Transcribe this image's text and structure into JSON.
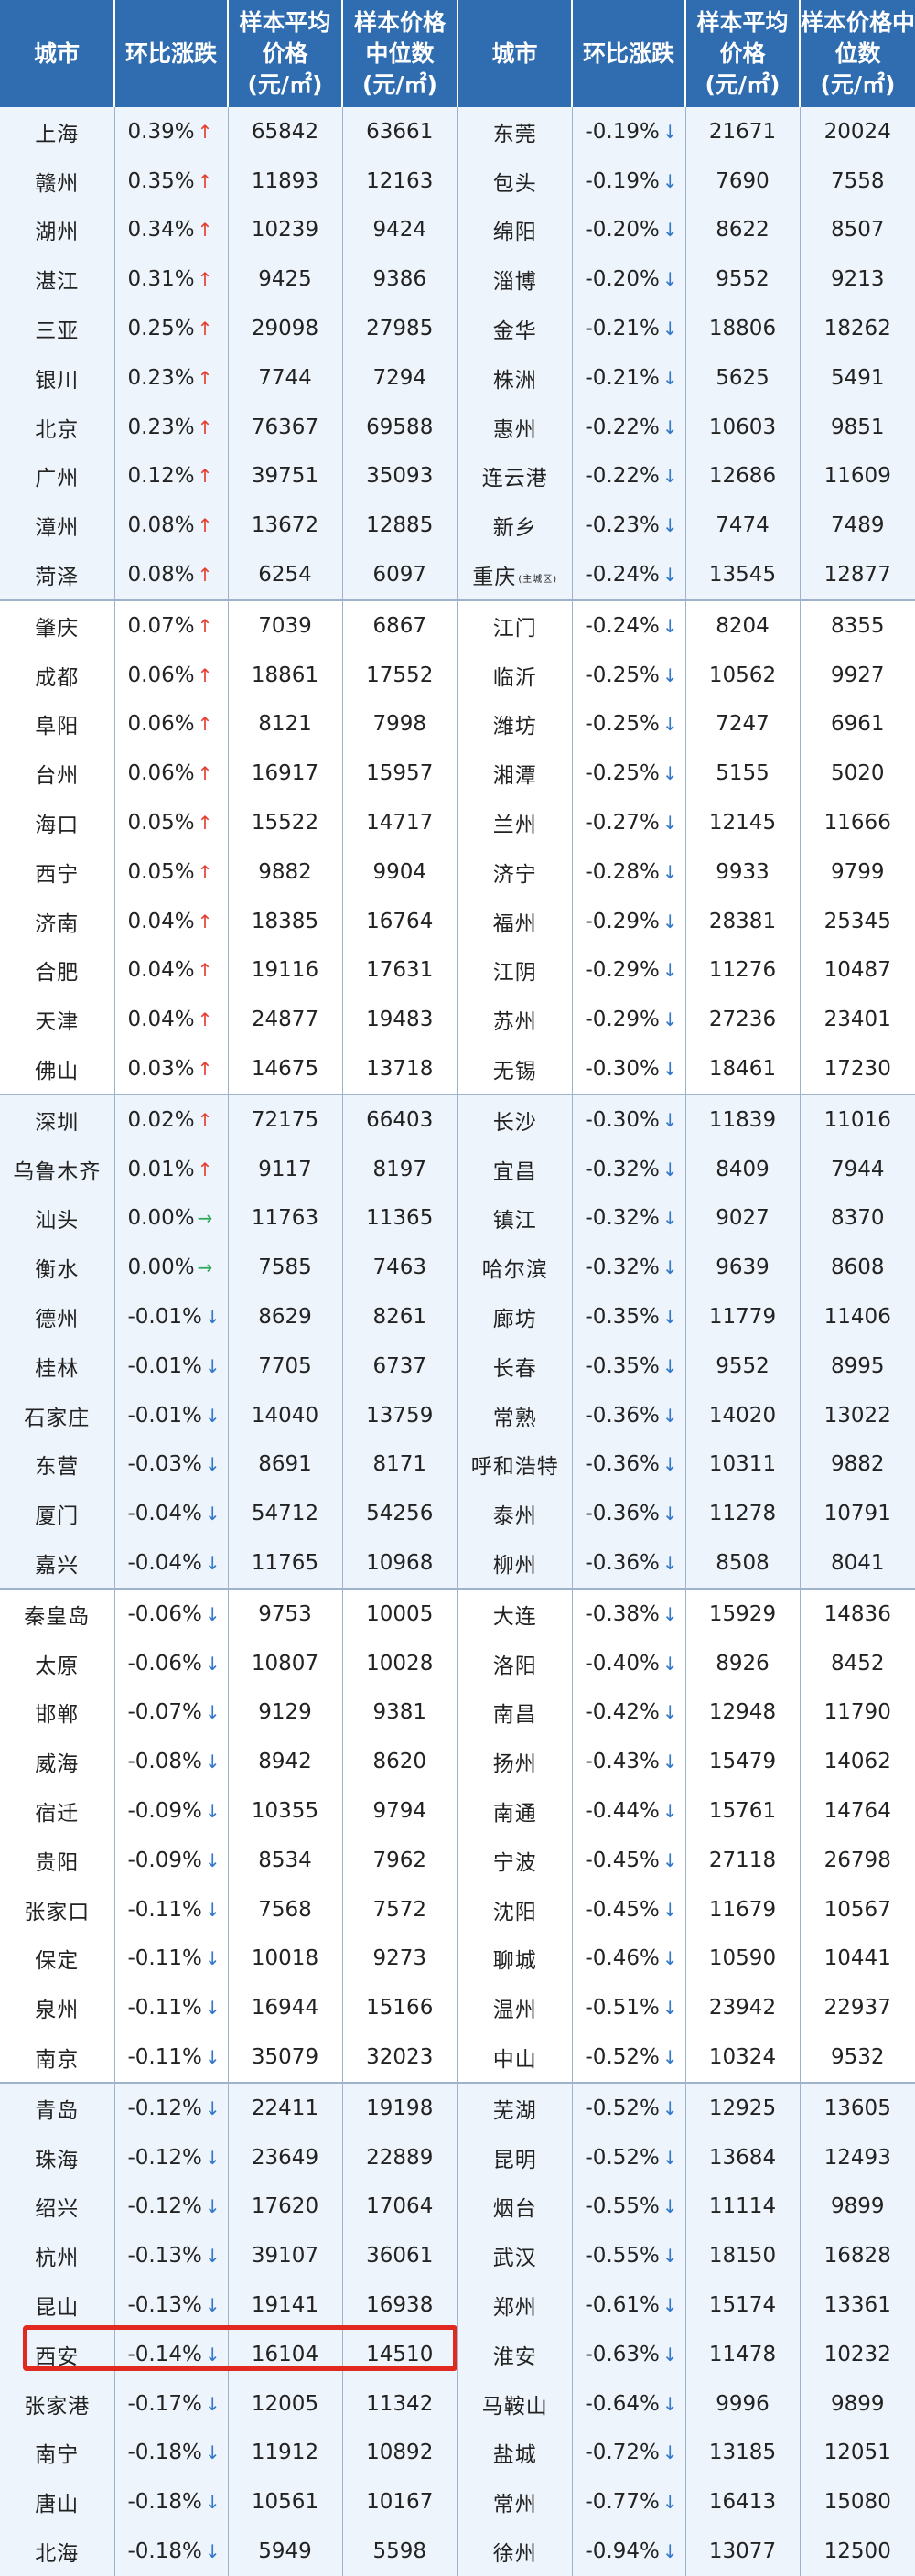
{
  "header": {
    "city": "城市",
    "change": "环比涨跌",
    "avg_price": "样本平均价格",
    "avg_unit": "(元/㎡)",
    "median_price": "样本价格中位数",
    "median_unit": "(元/㎡)"
  },
  "highlighted_city": "西安",
  "colors": {
    "header_bg": "#2f6db0",
    "up": "#e43d30",
    "down": "#3378c9",
    "flat": "#2aa75a",
    "highlight": "#e1291f"
  },
  "rows": [
    {
      "left": {
        "city": "上海",
        "change": "0.39%",
        "dir": "up",
        "avg": "65842",
        "median": "63661"
      },
      "right": {
        "city": "东莞",
        "change": "-0.19%",
        "dir": "down",
        "avg": "21671",
        "median": "20024"
      }
    },
    {
      "left": {
        "city": "赣州",
        "change": "0.35%",
        "dir": "up",
        "avg": "11893",
        "median": "12163"
      },
      "right": {
        "city": "包头",
        "change": "-0.19%",
        "dir": "down",
        "avg": "7690",
        "median": "7558"
      }
    },
    {
      "left": {
        "city": "湖州",
        "change": "0.34%",
        "dir": "up",
        "avg": "10239",
        "median": "9424"
      },
      "right": {
        "city": "绵阳",
        "change": "-0.20%",
        "dir": "down",
        "avg": "8622",
        "median": "8507"
      }
    },
    {
      "left": {
        "city": "湛江",
        "change": "0.31%",
        "dir": "up",
        "avg": "9425",
        "median": "9386"
      },
      "right": {
        "city": "淄博",
        "change": "-0.20%",
        "dir": "down",
        "avg": "9552",
        "median": "9213"
      }
    },
    {
      "left": {
        "city": "三亚",
        "change": "0.25%",
        "dir": "up",
        "avg": "29098",
        "median": "27985"
      },
      "right": {
        "city": "金华",
        "change": "-0.21%",
        "dir": "down",
        "avg": "18806",
        "median": "18262"
      }
    },
    {
      "left": {
        "city": "银川",
        "change": "0.23%",
        "dir": "up",
        "avg": "7744",
        "median": "7294"
      },
      "right": {
        "city": "株洲",
        "change": "-0.21%",
        "dir": "down",
        "avg": "5625",
        "median": "5491"
      }
    },
    {
      "left": {
        "city": "北京",
        "change": "0.23%",
        "dir": "up",
        "avg": "76367",
        "median": "69588"
      },
      "right": {
        "city": "惠州",
        "change": "-0.22%",
        "dir": "down",
        "avg": "10603",
        "median": "9851"
      }
    },
    {
      "left": {
        "city": "广州",
        "change": "0.12%",
        "dir": "up",
        "avg": "39751",
        "median": "35093"
      },
      "right": {
        "city": "连云港",
        "change": "-0.22%",
        "dir": "down",
        "avg": "12686",
        "median": "11609"
      }
    },
    {
      "left": {
        "city": "漳州",
        "change": "0.08%",
        "dir": "up",
        "avg": "13672",
        "median": "12885"
      },
      "right": {
        "city": "新乡",
        "change": "-0.23%",
        "dir": "down",
        "avg": "7474",
        "median": "7489"
      }
    },
    {
      "left": {
        "city": "菏泽",
        "change": "0.08%",
        "dir": "up",
        "avg": "6254",
        "median": "6097"
      },
      "right": {
        "city": "重庆",
        "suffix": "(主城区)",
        "change": "-0.24%",
        "dir": "down",
        "avg": "13545",
        "median": "12877"
      }
    },
    {
      "left": {
        "city": "肇庆",
        "change": "0.07%",
        "dir": "up",
        "avg": "7039",
        "median": "6867"
      },
      "right": {
        "city": "江门",
        "change": "-0.24%",
        "dir": "down",
        "avg": "8204",
        "median": "8355"
      }
    },
    {
      "left": {
        "city": "成都",
        "change": "0.06%",
        "dir": "up",
        "avg": "18861",
        "median": "17552"
      },
      "right": {
        "city": "临沂",
        "change": "-0.25%",
        "dir": "down",
        "avg": "10562",
        "median": "9927"
      }
    },
    {
      "left": {
        "city": "阜阳",
        "change": "0.06%",
        "dir": "up",
        "avg": "8121",
        "median": "7998"
      },
      "right": {
        "city": "潍坊",
        "change": "-0.25%",
        "dir": "down",
        "avg": "7247",
        "median": "6961"
      }
    },
    {
      "left": {
        "city": "台州",
        "change": "0.06%",
        "dir": "up",
        "avg": "16917",
        "median": "15957"
      },
      "right": {
        "city": "湘潭",
        "change": "-0.25%",
        "dir": "down",
        "avg": "5155",
        "median": "5020"
      }
    },
    {
      "left": {
        "city": "海口",
        "change": "0.05%",
        "dir": "up",
        "avg": "15522",
        "median": "14717"
      },
      "right": {
        "city": "兰州",
        "change": "-0.27%",
        "dir": "down",
        "avg": "12145",
        "median": "11666"
      }
    },
    {
      "left": {
        "city": "西宁",
        "change": "0.05%",
        "dir": "up",
        "avg": "9882",
        "median": "9904"
      },
      "right": {
        "city": "济宁",
        "change": "-0.28%",
        "dir": "down",
        "avg": "9933",
        "median": "9799"
      }
    },
    {
      "left": {
        "city": "济南",
        "change": "0.04%",
        "dir": "up",
        "avg": "18385",
        "median": "16764"
      },
      "right": {
        "city": "福州",
        "change": "-0.29%",
        "dir": "down",
        "avg": "28381",
        "median": "25345"
      }
    },
    {
      "left": {
        "city": "合肥",
        "change": "0.04%",
        "dir": "up",
        "avg": "19116",
        "median": "17631"
      },
      "right": {
        "city": "江阴",
        "change": "-0.29%",
        "dir": "down",
        "avg": "11276",
        "median": "10487"
      }
    },
    {
      "left": {
        "city": "天津",
        "change": "0.04%",
        "dir": "up",
        "avg": "24877",
        "median": "19483"
      },
      "right": {
        "city": "苏州",
        "change": "-0.29%",
        "dir": "down",
        "avg": "27236",
        "median": "23401"
      }
    },
    {
      "left": {
        "city": "佛山",
        "change": "0.03%",
        "dir": "up",
        "avg": "14675",
        "median": "13718"
      },
      "right": {
        "city": "无锡",
        "change": "-0.30%",
        "dir": "down",
        "avg": "18461",
        "median": "17230"
      }
    },
    {
      "left": {
        "city": "深圳",
        "change": "0.02%",
        "dir": "up",
        "avg": "72175",
        "median": "66403"
      },
      "right": {
        "city": "长沙",
        "change": "-0.30%",
        "dir": "down",
        "avg": "11839",
        "median": "11016"
      }
    },
    {
      "left": {
        "city": "乌鲁木齐",
        "change": "0.01%",
        "dir": "up",
        "avg": "9117",
        "median": "8197"
      },
      "right": {
        "city": "宜昌",
        "change": "-0.32%",
        "dir": "down",
        "avg": "8409",
        "median": "7944"
      }
    },
    {
      "left": {
        "city": "汕头",
        "change": "0.00%",
        "dir": "flat",
        "avg": "11763",
        "median": "11365"
      },
      "right": {
        "city": "镇江",
        "change": "-0.32%",
        "dir": "down",
        "avg": "9027",
        "median": "8370"
      }
    },
    {
      "left": {
        "city": "衡水",
        "change": "0.00%",
        "dir": "flat",
        "avg": "7585",
        "median": "7463"
      },
      "right": {
        "city": "哈尔滨",
        "change": "-0.32%",
        "dir": "down",
        "avg": "9639",
        "median": "8608"
      }
    },
    {
      "left": {
        "city": "德州",
        "change": "-0.01%",
        "dir": "down",
        "avg": "8629",
        "median": "8261"
      },
      "right": {
        "city": "廊坊",
        "change": "-0.35%",
        "dir": "down",
        "avg": "11779",
        "median": "11406"
      }
    },
    {
      "left": {
        "city": "桂林",
        "change": "-0.01%",
        "dir": "down",
        "avg": "7705",
        "median": "6737"
      },
      "right": {
        "city": "长春",
        "change": "-0.35%",
        "dir": "down",
        "avg": "9552",
        "median": "8995"
      }
    },
    {
      "left": {
        "city": "石家庄",
        "change": "-0.01%",
        "dir": "down",
        "avg": "14040",
        "median": "13759"
      },
      "right": {
        "city": "常熟",
        "change": "-0.36%",
        "dir": "down",
        "avg": "14020",
        "median": "13022"
      }
    },
    {
      "left": {
        "city": "东营",
        "change": "-0.03%",
        "dir": "down",
        "avg": "8691",
        "median": "8171"
      },
      "right": {
        "city": "呼和浩特",
        "change": "-0.36%",
        "dir": "down",
        "avg": "10311",
        "median": "9882"
      }
    },
    {
      "left": {
        "city": "厦门",
        "change": "-0.04%",
        "dir": "down",
        "avg": "54712",
        "median": "54256"
      },
      "right": {
        "city": "泰州",
        "change": "-0.36%",
        "dir": "down",
        "avg": "11278",
        "median": "10791"
      }
    },
    {
      "left": {
        "city": "嘉兴",
        "change": "-0.04%",
        "dir": "down",
        "avg": "11765",
        "median": "10968"
      },
      "right": {
        "city": "柳州",
        "change": "-0.36%",
        "dir": "down",
        "avg": "8508",
        "median": "8041"
      }
    },
    {
      "left": {
        "city": "秦皇岛",
        "change": "-0.06%",
        "dir": "down",
        "avg": "9753",
        "median": "10005"
      },
      "right": {
        "city": "大连",
        "change": "-0.38%",
        "dir": "down",
        "avg": "15929",
        "median": "14836"
      }
    },
    {
      "left": {
        "city": "太原",
        "change": "-0.06%",
        "dir": "down",
        "avg": "10807",
        "median": "10028"
      },
      "right": {
        "city": "洛阳",
        "change": "-0.40%",
        "dir": "down",
        "avg": "8926",
        "median": "8452"
      }
    },
    {
      "left": {
        "city": "邯郸",
        "change": "-0.07%",
        "dir": "down",
        "avg": "9129",
        "median": "9381"
      },
      "right": {
        "city": "南昌",
        "change": "-0.42%",
        "dir": "down",
        "avg": "12948",
        "median": "11790"
      }
    },
    {
      "left": {
        "city": "威海",
        "change": "-0.08%",
        "dir": "down",
        "avg": "8942",
        "median": "8620"
      },
      "right": {
        "city": "扬州",
        "change": "-0.43%",
        "dir": "down",
        "avg": "15479",
        "median": "14062"
      }
    },
    {
      "left": {
        "city": "宿迁",
        "change": "-0.09%",
        "dir": "down",
        "avg": "10355",
        "median": "9794"
      },
      "right": {
        "city": "南通",
        "change": "-0.44%",
        "dir": "down",
        "avg": "15761",
        "median": "14764"
      }
    },
    {
      "left": {
        "city": "贵阳",
        "change": "-0.09%",
        "dir": "down",
        "avg": "8534",
        "median": "7962"
      },
      "right": {
        "city": "宁波",
        "change": "-0.45%",
        "dir": "down",
        "avg": "27118",
        "median": "26798"
      }
    },
    {
      "left": {
        "city": "张家口",
        "change": "-0.11%",
        "dir": "down",
        "avg": "7568",
        "median": "7572"
      },
      "right": {
        "city": "沈阳",
        "change": "-0.45%",
        "dir": "down",
        "avg": "11679",
        "median": "10567"
      }
    },
    {
      "left": {
        "city": "保定",
        "change": "-0.11%",
        "dir": "down",
        "avg": "10018",
        "median": "9273"
      },
      "right": {
        "city": "聊城",
        "change": "-0.46%",
        "dir": "down",
        "avg": "10590",
        "median": "10441"
      }
    },
    {
      "left": {
        "city": "泉州",
        "change": "-0.11%",
        "dir": "down",
        "avg": "16944",
        "median": "15166"
      },
      "right": {
        "city": "温州",
        "change": "-0.51%",
        "dir": "down",
        "avg": "23942",
        "median": "22937"
      }
    },
    {
      "left": {
        "city": "南京",
        "change": "-0.11%",
        "dir": "down",
        "avg": "35079",
        "median": "32023"
      },
      "right": {
        "city": "中山",
        "change": "-0.52%",
        "dir": "down",
        "avg": "10324",
        "median": "9532"
      }
    },
    {
      "left": {
        "city": "青岛",
        "change": "-0.12%",
        "dir": "down",
        "avg": "22411",
        "median": "19198"
      },
      "right": {
        "city": "芜湖",
        "change": "-0.52%",
        "dir": "down",
        "avg": "12925",
        "median": "13605"
      }
    },
    {
      "left": {
        "city": "珠海",
        "change": "-0.12%",
        "dir": "down",
        "avg": "23649",
        "median": "22889"
      },
      "right": {
        "city": "昆明",
        "change": "-0.52%",
        "dir": "down",
        "avg": "13684",
        "median": "12493"
      }
    },
    {
      "left": {
        "city": "绍兴",
        "change": "-0.12%",
        "dir": "down",
        "avg": "17620",
        "median": "17064"
      },
      "right": {
        "city": "烟台",
        "change": "-0.55%",
        "dir": "down",
        "avg": "11114",
        "median": "9899"
      }
    },
    {
      "left": {
        "city": "杭州",
        "change": "-0.13%",
        "dir": "down",
        "avg": "39107",
        "median": "36061"
      },
      "right": {
        "city": "武汉",
        "change": "-0.55%",
        "dir": "down",
        "avg": "18150",
        "median": "16828"
      }
    },
    {
      "left": {
        "city": "昆山",
        "change": "-0.13%",
        "dir": "down",
        "avg": "19141",
        "median": "16938"
      },
      "right": {
        "city": "郑州",
        "change": "-0.61%",
        "dir": "down",
        "avg": "15174",
        "median": "13361"
      }
    },
    {
      "left": {
        "city": "西安",
        "change": "-0.14%",
        "dir": "down",
        "avg": "16104",
        "median": "14510"
      },
      "right": {
        "city": "淮安",
        "change": "-0.63%",
        "dir": "down",
        "avg": "11478",
        "median": "10232"
      }
    },
    {
      "left": {
        "city": "张家港",
        "change": "-0.17%",
        "dir": "down",
        "avg": "12005",
        "median": "11342"
      },
      "right": {
        "city": "马鞍山",
        "change": "-0.64%",
        "dir": "down",
        "avg": "9996",
        "median": "9899"
      }
    },
    {
      "left": {
        "city": "南宁",
        "change": "-0.18%",
        "dir": "down",
        "avg": "11912",
        "median": "10892"
      },
      "right": {
        "city": "盐城",
        "change": "-0.72%",
        "dir": "down",
        "avg": "13185",
        "median": "12051"
      }
    },
    {
      "left": {
        "city": "唐山",
        "change": "-0.18%",
        "dir": "down",
        "avg": "10561",
        "median": "10167"
      },
      "right": {
        "city": "常州",
        "change": "-0.77%",
        "dir": "down",
        "avg": "16413",
        "median": "15080"
      }
    },
    {
      "left": {
        "city": "北海",
        "change": "-0.18%",
        "dir": "down",
        "avg": "5949",
        "median": "5598"
      },
      "right": {
        "city": "徐州",
        "change": "-0.94%",
        "dir": "down",
        "avg": "13077",
        "median": "12500"
      }
    }
  ]
}
